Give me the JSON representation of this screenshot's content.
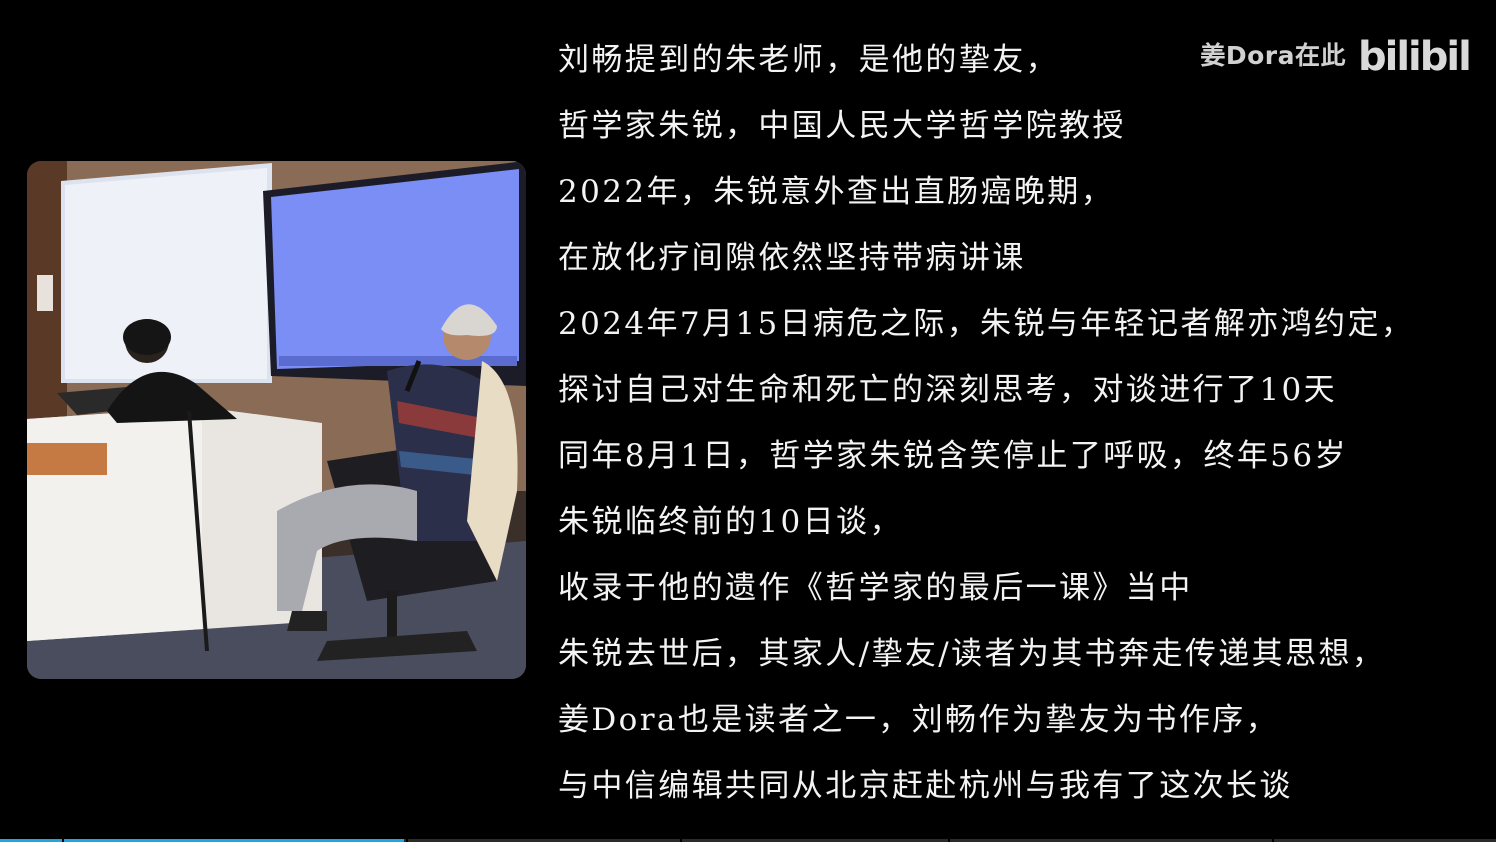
{
  "watermark": {
    "user": "姜Dora在此",
    "logo_icon": "bilibili-logo-icon",
    "logo_text": "bilibili"
  },
  "subtitles": [
    "刘畅提到的朱老师，是他的挚友，",
    "哲学家朱锐，中国人民大学哲学院教授",
    "2022年，朱锐意外查出直肠癌晚期，",
    "在放化疗间隙依然坚持带病讲课",
    "2024年7月15日病危之际，朱锐与年轻记者解亦鸿约定，",
    "探讨自己对生命和死亡的深刻思考，对谈进行了10天",
    "同年8月1日，哲学家朱锐含笑停止了呼吸，终年56岁",
    "朱锐临终前的10日谈，",
    "收录于他的遗作《哲学家的最后一课》当中",
    "朱锐去世后，其家人/挚友/读者为其书奔走传递其思想，",
    "姜Dora也是读者之一，刘畅作为挚友为书作序，",
    "与中信编辑共同从北京赶赴杭州与我有了这次长谈"
  ],
  "photo": {
    "description_icon": "lecture-photo"
  },
  "progress": {
    "played_fraction": 0.27,
    "color": "#1ea6e0"
  },
  "colors": {
    "background": "#000000",
    "text": "#f3f3f3",
    "accent": "#1ea6e0"
  }
}
